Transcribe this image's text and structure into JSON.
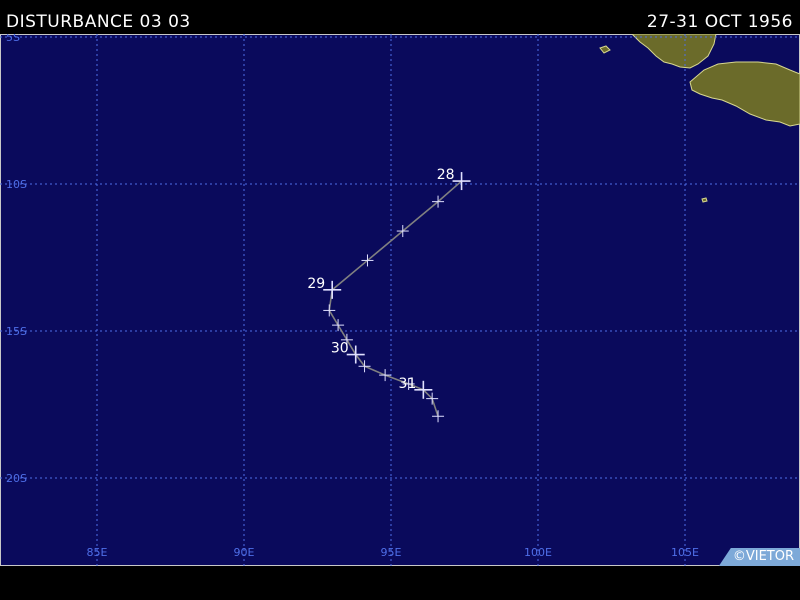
{
  "header": {
    "title": "DISTURBANCE 03 03",
    "date_range": "27-31 OCT 1956"
  },
  "map": {
    "ocean_color": "#0a0a5c",
    "land_fill_color": "#6b6b2a",
    "coast_color": "#d8d890",
    "grid_color": "#4f6fe8",
    "track_color": "#808080",
    "marker_color": "#e0e0ff",
    "lat_labels": [
      {
        "lat": -5,
        "text": "5S"
      },
      {
        "lat": -10,
        "text": "10S"
      },
      {
        "lat": -15,
        "text": "15S"
      },
      {
        "lat": -20,
        "text": "20S"
      }
    ],
    "lon_labels": [
      {
        "lon": 85,
        "text": "85E"
      },
      {
        "lon": 90,
        "text": "90E"
      },
      {
        "lon": 95,
        "text": "95E"
      },
      {
        "lon": 100,
        "text": "100E"
      },
      {
        "lon": 105,
        "text": "105E"
      }
    ],
    "track": [
      {
        "lat": -9.9,
        "lon": 97.4,
        "day_label": "28"
      },
      {
        "lat": -10.6,
        "lon": 96.6
      },
      {
        "lat": -11.6,
        "lon": 95.4
      },
      {
        "lat": -12.6,
        "lon": 94.2
      },
      {
        "lat": -13.6,
        "lon": 93.0,
        "day_label": "29"
      },
      {
        "lat": -14.3,
        "lon": 92.9
      },
      {
        "lat": -14.8,
        "lon": 93.2
      },
      {
        "lat": -15.3,
        "lon": 93.5
      },
      {
        "lat": -15.8,
        "lon": 93.8,
        "day_label": "30"
      },
      {
        "lat": -16.2,
        "lon": 94.1
      },
      {
        "lat": -16.5,
        "lon": 94.8
      },
      {
        "lat": -16.8,
        "lon": 95.6
      },
      {
        "lat": -17.0,
        "lon": 96.1,
        "day_label": "31"
      },
      {
        "lat": -17.3,
        "lon": 96.4
      },
      {
        "lat": -17.9,
        "lon": 96.6
      }
    ]
  },
  "footer": {
    "credit": "©VIETOR"
  }
}
